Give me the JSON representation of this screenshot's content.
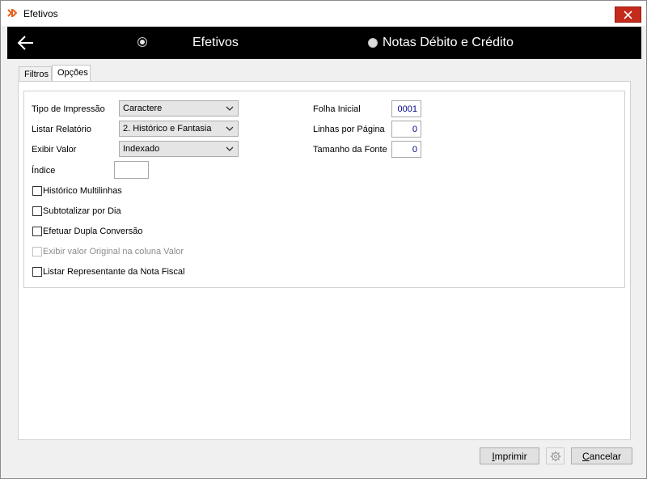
{
  "window": {
    "title": "Efetivos"
  },
  "header": {
    "options": [
      {
        "label": "Efetivos",
        "selected": true
      },
      {
        "label": "Notas Débito e Crédito",
        "selected": false
      }
    ]
  },
  "tabs": [
    {
      "label": "Filtros",
      "active": false
    },
    {
      "label": "Opções",
      "active": true
    }
  ],
  "form": {
    "tipo_impressao": {
      "label": "Tipo de Impressão",
      "value": "Caractere"
    },
    "listar_relatorio": {
      "label": "Listar Relatório",
      "value": "2. Histórico e Fantasia"
    },
    "exibir_valor": {
      "label": "Exibir Valor",
      "value": "Indexado"
    },
    "indice": {
      "label": "Índice",
      "value": ""
    },
    "folha_inicial": {
      "label": "Folha Inicial",
      "value": "0001"
    },
    "linhas_por_pagina": {
      "label": "Linhas por Página",
      "value": "0"
    },
    "tamanho_fonte": {
      "label": "Tamanho da Fonte",
      "value": "0"
    },
    "checkboxes": [
      {
        "label": "Histórico Multilinhas",
        "checked": false,
        "enabled": true
      },
      {
        "label": "Subtotalizar por Dia",
        "checked": false,
        "enabled": true
      },
      {
        "label": "Efetuar Dupla Conversão",
        "checked": false,
        "enabled": true
      },
      {
        "label": "Exibir valor Original na coluna Valor",
        "checked": false,
        "enabled": false
      },
      {
        "label": "Listar Representante da Nota Fiscal",
        "checked": false,
        "enabled": true
      }
    ]
  },
  "buttons": {
    "print": "Imprimir",
    "settings_icon": "gear-icon",
    "cancel": "Cancelar"
  },
  "colors": {
    "header_bg": "#000000",
    "close_red": "#c42b1c",
    "value_blue": "#00008b"
  }
}
